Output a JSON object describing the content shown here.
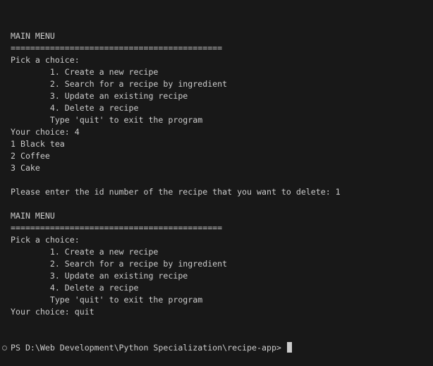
{
  "terminal": {
    "lines": [
      "MAIN MENU",
      "===========================================",
      "Pick a choice:",
      "        1. Create a new recipe",
      "        2. Search for a recipe by ingredient",
      "        3. Update an existing recipe",
      "        4. Delete a recipe",
      "        Type 'quit' to exit the program",
      "Your choice: 4",
      "1 Black tea",
      "2 Coffee",
      "3 Cake",
      "",
      "Please enter the id number of the recipe that you want to delete: 1",
      "",
      "MAIN MENU",
      "===========================================",
      "Pick a choice:",
      "        1. Create a new recipe",
      "        2. Search for a recipe by ingredient",
      "        3. Update an existing recipe",
      "        4. Delete a recipe",
      "        Type 'quit' to exit the program",
      "Your choice: quit"
    ],
    "prompt": "PS D:\\Web Development\\Python Specialization\\recipe-app> "
  }
}
